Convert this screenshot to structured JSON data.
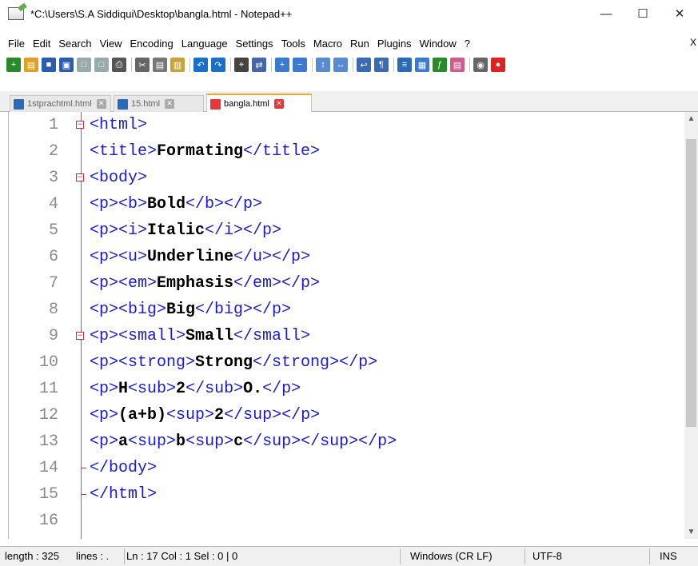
{
  "window": {
    "title": "*C:\\Users\\S.A Siddiqui\\Desktop\\bangla.html - Notepad++",
    "minimize": "—",
    "maximize": "☐",
    "close": "✕"
  },
  "menu": {
    "items": [
      "File",
      "Edit",
      "Search",
      "View",
      "Encoding",
      "Language",
      "Settings",
      "Tools",
      "Macro",
      "Run",
      "Plugins",
      "Window",
      "?"
    ],
    "close_label": "X"
  },
  "toolbar": {
    "icons": [
      "new-file-icon",
      "open-file-icon",
      "save-icon",
      "save-all-icon",
      "close-icon",
      "close-all-icon",
      "print-icon",
      "cut-icon",
      "copy-icon",
      "paste-icon",
      "undo-icon",
      "redo-icon",
      "find-icon",
      "replace-icon",
      "zoom-in-icon",
      "zoom-out-icon",
      "sync-vertical-icon",
      "sync-horizontal-icon",
      "word-wrap-icon",
      "show-all-chars-icon",
      "indent-guide-icon",
      "doc-map-icon",
      "function-list-icon",
      "folder-workspace-icon",
      "monitoring-icon",
      "record-macro-icon"
    ]
  },
  "tabs": [
    {
      "label": "1stprachtml.html",
      "active": false
    },
    {
      "label": "15.html",
      "active": false
    },
    {
      "label": "bangla.html",
      "active": true
    }
  ],
  "editor": {
    "lines": [
      {
        "num": "1",
        "fold": "open",
        "parts": [
          [
            "t",
            "<html>"
          ]
        ]
      },
      {
        "num": "2",
        "fold": "",
        "parts": [
          [
            "t",
            "<title>"
          ],
          [
            "b",
            "Formating"
          ],
          [
            "t",
            "</title>"
          ]
        ]
      },
      {
        "num": "3",
        "fold": "open",
        "parts": [
          [
            "t",
            "<body>"
          ]
        ]
      },
      {
        "num": "4",
        "fold": "",
        "parts": [
          [
            "t",
            "<p><b>"
          ],
          [
            "b",
            "Bold"
          ],
          [
            "t",
            "</b></p>"
          ]
        ]
      },
      {
        "num": "5",
        "fold": "",
        "parts": [
          [
            "t",
            "<p><i>"
          ],
          [
            "b",
            "Italic"
          ],
          [
            "t",
            "</i></p>"
          ]
        ]
      },
      {
        "num": "6",
        "fold": "",
        "parts": [
          [
            "t",
            "<p><u>"
          ],
          [
            "b",
            "Underline"
          ],
          [
            "t",
            "</u></p>"
          ]
        ]
      },
      {
        "num": "7",
        "fold": "",
        "parts": [
          [
            "t",
            "<p><em>"
          ],
          [
            "b",
            "Emphasis"
          ],
          [
            "t",
            "</em></p>"
          ]
        ]
      },
      {
        "num": "8",
        "fold": "",
        "parts": [
          [
            "t",
            "<p><big>"
          ],
          [
            "b",
            "Big"
          ],
          [
            "t",
            "</big></p>"
          ]
        ]
      },
      {
        "num": "9",
        "fold": "open",
        "parts": [
          [
            "t",
            "<p><small>"
          ],
          [
            "b",
            "Small"
          ],
          [
            "t",
            "</small>"
          ]
        ]
      },
      {
        "num": "10",
        "fold": "",
        "parts": [
          [
            "t",
            "<p><strong>"
          ],
          [
            "b",
            "Strong"
          ],
          [
            "t",
            "</strong></p>"
          ]
        ]
      },
      {
        "num": "11",
        "fold": "",
        "parts": [
          [
            "t",
            "<p>"
          ],
          [
            "b",
            "H"
          ],
          [
            "t",
            "<sub>"
          ],
          [
            "b",
            "2"
          ],
          [
            "t",
            "</sub>"
          ],
          [
            "b",
            "O."
          ],
          [
            "t",
            "</p>"
          ]
        ]
      },
      {
        "num": "12",
        "fold": "",
        "parts": [
          [
            "t",
            "<p>"
          ],
          [
            "b",
            "(a+b)"
          ],
          [
            "t",
            "<sup>"
          ],
          [
            "b",
            "2"
          ],
          [
            "t",
            "</sup></p>"
          ]
        ]
      },
      {
        "num": "13",
        "fold": "",
        "parts": [
          [
            "t",
            "<p>"
          ],
          [
            "b",
            "a"
          ],
          [
            "t",
            "<sup>"
          ],
          [
            "b",
            "b"
          ],
          [
            "t",
            "<sup>"
          ],
          [
            "b",
            "c"
          ],
          [
            "t",
            "</sup></sup></p>"
          ]
        ]
      },
      {
        "num": "14",
        "fold": "end",
        "parts": [
          [
            "t",
            "</body>"
          ]
        ]
      },
      {
        "num": "15",
        "fold": "end",
        "parts": [
          [
            "t",
            "</html>"
          ]
        ]
      },
      {
        "num": "16",
        "fold": "",
        "parts": []
      }
    ]
  },
  "status": {
    "length": "length : 325",
    "lines": "lines : .",
    "position": "Ln : 17    Col : 1    Sel : 0 | 0",
    "eol": "Windows (CR LF)",
    "encoding": "UTF-8",
    "mode": "INS"
  },
  "colors": {
    "tag": "#1a1ad6",
    "text": "#000000",
    "line_number": "#8a8a8a",
    "fold_margin": "#e34b4b",
    "active_tab_accent": "#f5a623"
  }
}
